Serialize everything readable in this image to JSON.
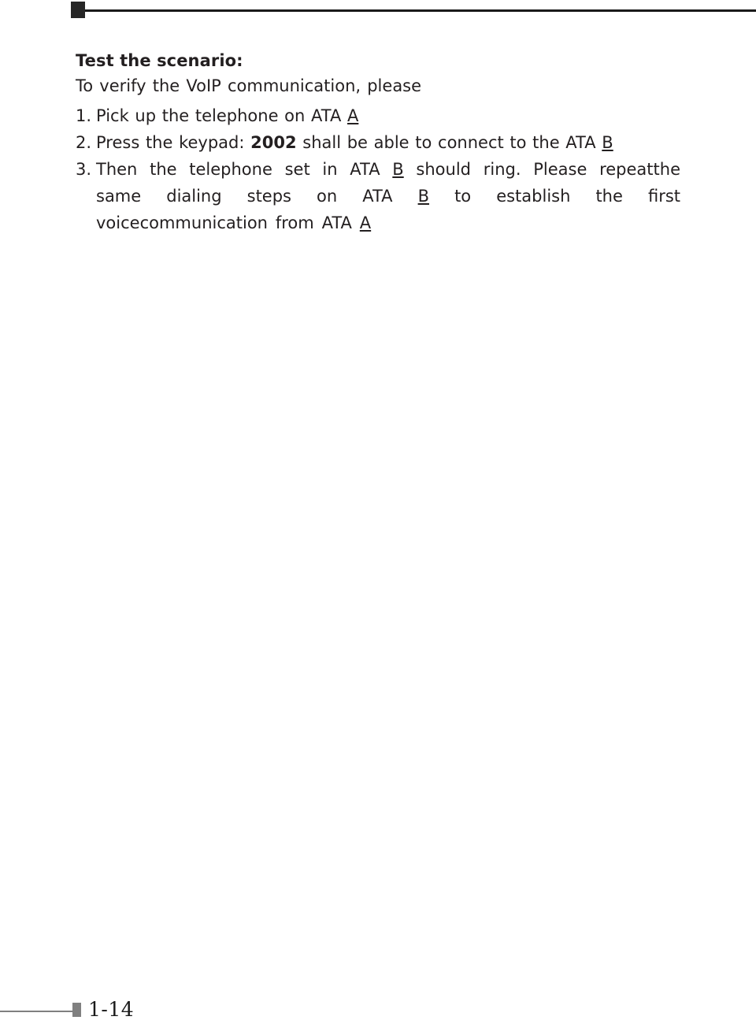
{
  "header": {
    "mark": "header-square-mark",
    "rule": "header-horizontal-rule",
    "rule_color": "#1a1a1a"
  },
  "document": {
    "section_title": "Test the scenario:",
    "intro": "To verify the VoIP communication, please",
    "steps": [
      {
        "number": "1.",
        "parts": [
          {
            "text": "Pick up the telephone on ATA ",
            "style": "normal"
          },
          {
            "text": "A",
            "style": "underline"
          }
        ],
        "plain": "1. Pick up the telephone on ATA A"
      },
      {
        "number": "2.",
        "parts": [
          {
            "text": "Press the keypad: ",
            "style": "normal"
          },
          {
            "text": "2002",
            "style": "bold"
          },
          {
            "text": " shall be able to connect to the ATA ",
            "style": "normal"
          },
          {
            "text": "B",
            "style": "underline"
          }
        ],
        "plain": "2. Press the keypad: 2002 shall be able to connect to the ATA B"
      },
      {
        "number": "3.",
        "parts": [
          {
            "text": "Then the telephone set in ATA ",
            "style": "normal"
          },
          {
            "text": "B",
            "style": "underline"
          },
          {
            "text": " should ring. Please repeat the same dialing steps on ATA ",
            "style": "normal"
          },
          {
            "text": "B",
            "style": "underline"
          },
          {
            "text": " to establish the first voice communication from ATA ",
            "style": "normal"
          },
          {
            "text": "A",
            "style": "underline"
          }
        ],
        "plain": "3. Then the telephone set in ATA B should ring. Please repeat the same dialing steps on ATA B to establish the first voice communication from ATA A"
      }
    ],
    "step3_lines": {
      "line1_a": "Then the telephone set in ATA ",
      "line1_b": "B",
      "line1_c": " should ring. Please repeat",
      "line2_a": "the same dialing steps on ATA ",
      "line2_b": "B",
      "line2_c": " to establish the first voice",
      "line3_a": "communication from ATA ",
      "line3_b": "A"
    }
  },
  "footer": {
    "page_number": "1-14",
    "mark": "footer-square-mark",
    "rule_color": "#808080"
  }
}
